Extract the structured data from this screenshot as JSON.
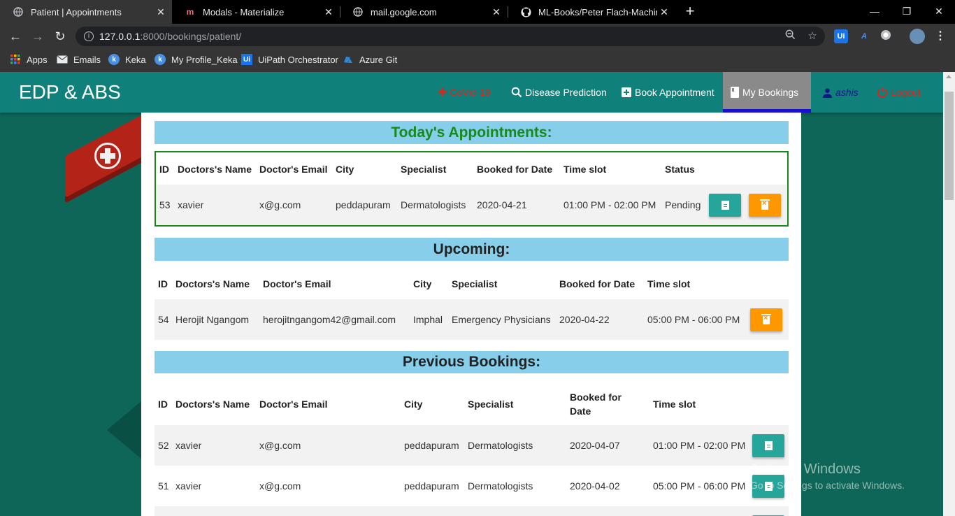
{
  "browser": {
    "tabs": [
      {
        "title": "Patient | Appointments",
        "active": true,
        "favicon": "globe-icon"
      },
      {
        "title": "Modals - Materialize",
        "active": false,
        "favicon": "materialize-icon"
      },
      {
        "title": "mail.google.com",
        "active": false,
        "favicon": "globe-icon"
      },
      {
        "title": "ML-Books/Peter Flach-Machine L",
        "active": false,
        "favicon": "github-icon"
      }
    ],
    "new_tab": "+",
    "window_controls": {
      "minimize": "—",
      "maximize": "❐",
      "close": "✕"
    },
    "url_host": "127.0.0.1",
    "url_rest": ":8000/bookings/patient/",
    "bookmarks": [
      {
        "label": "Apps",
        "icon": "apps-grid-icon"
      },
      {
        "label": "Emails",
        "icon": "mail-icon"
      },
      {
        "label": "Keka",
        "icon": "keka-icon"
      },
      {
        "label": "My Profile_Keka",
        "icon": "keka-icon"
      },
      {
        "label": "UiPath Orchestrator",
        "icon": "uipath-icon"
      },
      {
        "label": "Azure Git",
        "icon": "azure-icon"
      }
    ]
  },
  "navbar": {
    "brand": "EDP & ABS",
    "items": [
      {
        "label": "CoVid-19",
        "icon": "virus-icon"
      },
      {
        "label": "Disease Prediction",
        "icon": "search-icon"
      },
      {
        "label": "Book Appointment",
        "icon": "add-box-icon"
      },
      {
        "label": "My Bookings",
        "icon": "book-icon",
        "active": true
      },
      {
        "label": "ashis",
        "icon": "user-icon"
      },
      {
        "label": "Logout",
        "icon": "power-icon"
      }
    ]
  },
  "today": {
    "title": "Today's Appointments:",
    "headers": [
      "ID",
      "Doctors's Name",
      "Doctor's Email",
      "City",
      "Specialist",
      "Booked for Date",
      "Time slot",
      "Status"
    ],
    "rows": [
      {
        "id": "53",
        "name": "xavier",
        "email": "x@g.com",
        "city": "peddapuram",
        "specialist": "Dermatologists",
        "date": "2020-04-21",
        "slot": "01:00 PM - 02:00 PM",
        "status": "Pending"
      }
    ]
  },
  "upcoming": {
    "title": "Upcoming:",
    "headers": [
      "ID",
      "Doctors's Name",
      "Doctor's Email",
      "City",
      "Specialist",
      "Booked for Date",
      "Time slot"
    ],
    "rows": [
      {
        "id": "54",
        "name": "Herojit Ngangom",
        "email": "herojitngangom42@gmail.com",
        "city": "Imphal",
        "specialist": "Emergency Physicians",
        "date": "2020-04-22",
        "slot": "05:00 PM - 06:00 PM"
      }
    ]
  },
  "previous": {
    "title": "Previous Bookings:",
    "headers": [
      "ID",
      "Doctors's Name",
      "Doctor's Email",
      "City",
      "Specialist",
      "Booked for",
      "Date",
      "Time slot"
    ],
    "rows": [
      {
        "id": "52",
        "name": "xavier",
        "email": "x@g.com",
        "city": "peddapuram",
        "specialist": "Dermatologists",
        "date": "2020-04-07",
        "slot": "01:00 PM - 02:00 PM"
      },
      {
        "id": "51",
        "name": "xavier",
        "email": "x@g.com",
        "city": "peddapuram",
        "specialist": "Dermatologists",
        "date": "2020-04-02",
        "slot": "05:00 PM - 06:00 PM"
      }
    ]
  },
  "watermark": {
    "line1": "Activate Windows",
    "line2": "Go to Settings to activate Windows."
  },
  "colors": {
    "navbar": "#0f807a",
    "section_bg": "#87ceeb",
    "today_border": "#178a17",
    "teal_btn": "#26a69a",
    "orange_btn": "#ff9800"
  }
}
